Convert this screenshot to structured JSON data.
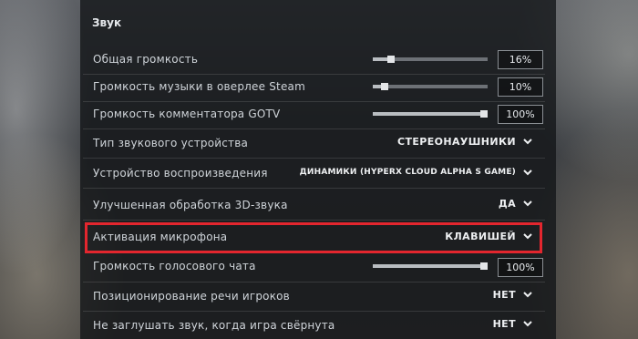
{
  "section": {
    "title": "Звук"
  },
  "rows": {
    "master_volume": {
      "label": "Общая громкость",
      "value": "16%",
      "level": 0.16
    },
    "music_volume": {
      "label": "Громкость музыки в оверлее Steam",
      "value": "10%",
      "level": 0.1
    },
    "gotv_volume": {
      "label": "Громкость комментатора GOTV",
      "value": "100%",
      "level": 1.0
    },
    "device_type": {
      "label": "Тип звукового устройства",
      "value": "СТЕРЕОНАУШНИКИ"
    },
    "playback_device": {
      "label": "Устройство воспроизведения",
      "value": "ДИНАМИКИ (HYPERX CLOUD ALPHA S GAME)"
    },
    "enhanced_3d": {
      "label": "Улучшенная обработка 3D-звука",
      "value": "ДА"
    },
    "mic_activation": {
      "label": "Активация микрофона",
      "value": "КЛАВИШЕЙ"
    },
    "voice_volume": {
      "label": "Громкость голосового чата",
      "value": "100%",
      "level": 1.0
    },
    "voice_positioning": {
      "label": "Позиционирование речи игроков",
      "value": "НЕТ"
    },
    "mute_unfocused": {
      "label": "Не заглушать звук, когда игра свёрнута",
      "value": "НЕТ"
    }
  },
  "colors": {
    "highlight": "#e3262e"
  },
  "icons": {
    "dropdown": "chevron-down-icon"
  }
}
